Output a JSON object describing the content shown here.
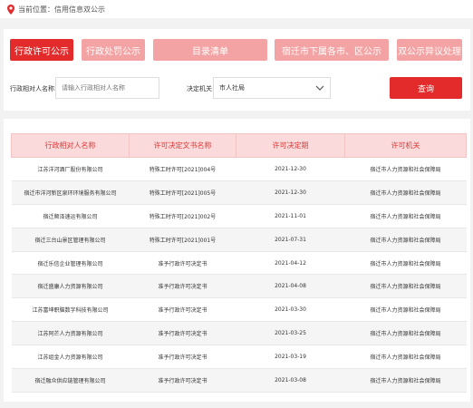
{
  "breadcrumb": {
    "label": "当前位置：",
    "current": "信用信息双公示"
  },
  "tabs": [
    {
      "label": "行政许可公示",
      "active": true
    },
    {
      "label": "行政处罚公示",
      "active": false
    },
    {
      "label": "目录清单",
      "active": false
    },
    {
      "label": "宿迁市下属各市、区公示",
      "active": false
    },
    {
      "label": "双公示异议处理",
      "active": false
    }
  ],
  "filters": {
    "counterparty_label": "行政相对人名称:",
    "counterparty_placeholder": "请输入行政相对人名称",
    "authority_label": "决定机关:",
    "authority_value": "市人社局",
    "query_label": "查询"
  },
  "table": {
    "headers": [
      "行政相对人名称",
      "许可决定文书名称",
      "许可决定期",
      "许可机关"
    ],
    "rows": [
      [
        "江苏洋河酒厂股份有限公司",
        "特殊工时许可[2021]004号",
        "2021-12-30",
        "宿迁市人力资源和社会保障局"
      ],
      [
        "宿迁市洋河新区泉环环境服务有限公司",
        "特殊工时许可[2021]005号",
        "2021-12-30",
        "宿迁市人力资源和社会保障局"
      ],
      [
        "宿迁顺泽速运有限公司",
        "特殊工时许可[2021]002号",
        "2021-11-01",
        "宿迁市人力资源和社会保障局"
      ],
      [
        "宿迁三台山景区管理有限公司",
        "特殊工时许可[2021]001号",
        "2021-07-31",
        "宿迁市人力资源和社会保障局"
      ],
      [
        "宿迁乐信企业管理有限公司",
        "准予行政许可决定书",
        "2021-04-12",
        "宿迁市人力资源和社会保障局"
      ],
      [
        "宿迁盛康人力资源有限公司",
        "准予行政许可决定书",
        "2021-04-08",
        "宿迁市人力资源和社会保障局"
      ],
      [
        "江苏富坤职脑数字科技有限公司",
        "准予行政许可决定书",
        "2021-03-30",
        "宿迁市人力资源和社会保障局"
      ],
      [
        "江苏阿芒人力资源有限公司",
        "准予行政许可决定书",
        "2021-03-25",
        "宿迁市人力资源和社会保障局"
      ],
      [
        "江苏组金人力资源有限公司",
        "准予行政许可决定书",
        "2021-03-19",
        "宿迁市人力资源和社会保障局"
      ],
      [
        "宿迁融众供应链管理有限公司",
        "准予行政许可决定书",
        "2021-03-08",
        "宿迁市人力资源和社会保障局"
      ]
    ]
  },
  "colors": {
    "accent": "#e32b2b",
    "accent_light": "#f3a3a3",
    "header_bg": "#fadada",
    "header_text": "#e03a3a"
  }
}
